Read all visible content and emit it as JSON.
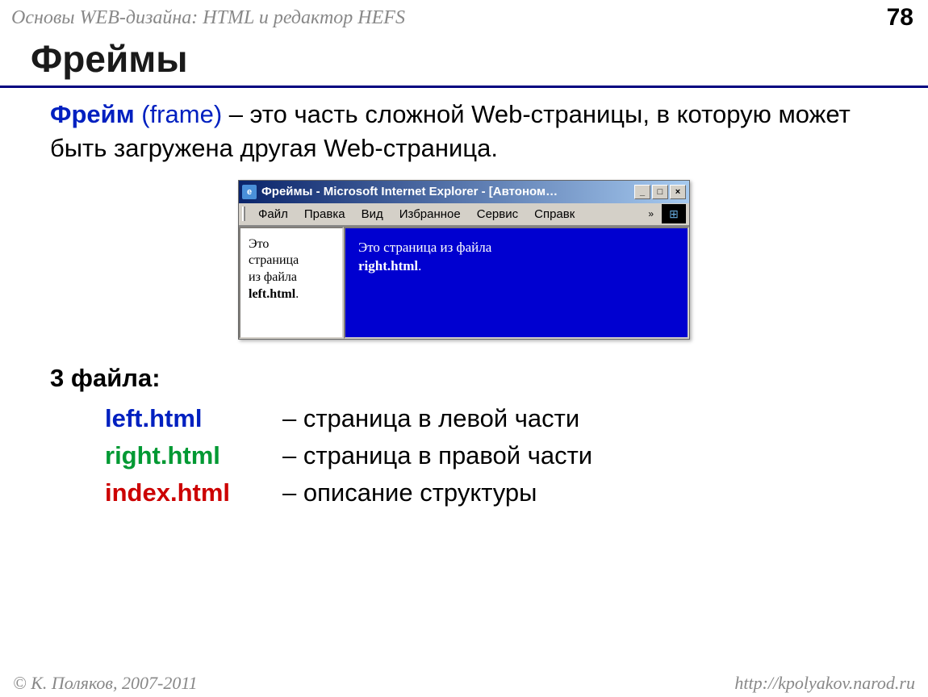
{
  "header": {
    "left": "Основы WEB-дизайна: HTML и редактор HEFS",
    "page": "78"
  },
  "title": "Фреймы",
  "definition": {
    "term": "Фрейм",
    "paren": "(frame)",
    "rest": " – это часть сложной Web-страницы, в которую может быть загружена другая Web-страница."
  },
  "browser": {
    "title": "Фреймы - Microsoft Internet Explorer - [Автоном…",
    "menus": [
      "Файл",
      "Правка",
      "Вид",
      "Избранное",
      "Сервис",
      "Справк"
    ],
    "win_min": "_",
    "win_max": "□",
    "win_close": "×",
    "frame_left_line1": "Это",
    "frame_left_line2": "страница",
    "frame_left_line3": "из файла",
    "frame_left_bold": "left.html",
    "frame_right_line1": "Это страница из файла",
    "frame_right_bold": "right.html"
  },
  "files_label": "3 файла:",
  "files": [
    {
      "name": "left.html",
      "desc": "– страница в левой части",
      "cls": "c-blue"
    },
    {
      "name": "right.html",
      "desc": "– страница в правой части",
      "cls": "c-green"
    },
    {
      "name": "index.html",
      "desc": "– описание структуры",
      "cls": "c-red"
    }
  ],
  "footer": {
    "left": "© К. Поляков, 2007-2011",
    "right": "http://kpolyakov.narod.ru"
  }
}
